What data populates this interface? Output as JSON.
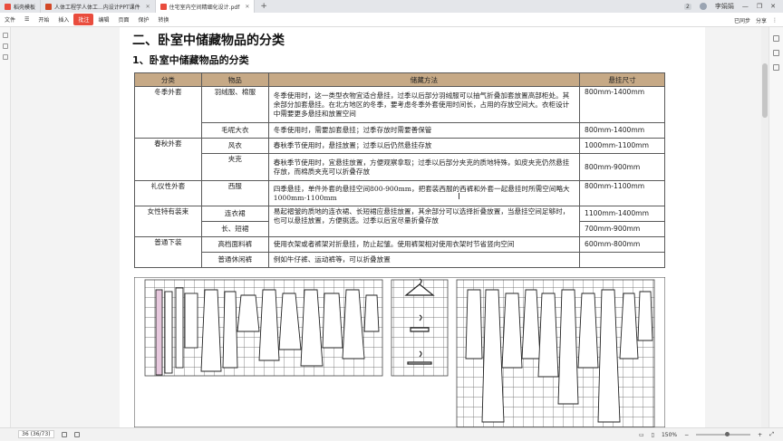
{
  "tabs": [
    {
      "label": "稻壳模板",
      "color": "#e94c3d",
      "active": false
    },
    {
      "label": "人体工程学人体工...内设计PPT课件",
      "color": "#d24726",
      "active": false
    },
    {
      "label": "住宅室内空间精细化设计.pdf",
      "color": "#e94c3d",
      "active": true
    }
  ],
  "window": {
    "badge": "2",
    "user": "李娟娟"
  },
  "menu": {
    "file": "文件",
    "items": [
      "开始",
      "插入",
      "批注",
      "编辑",
      "页面",
      "保护",
      "转换"
    ],
    "active_index": 2
  },
  "toolbar_right": {
    "sync": "已同步",
    "share": "分享"
  },
  "doc": {
    "heading": "二、卧室中储藏物品的分类",
    "subheading": "1、卧室中储藏物品的分类",
    "table": {
      "headers": [
        "分类",
        "物品",
        "储藏方法",
        "悬挂尺寸"
      ],
      "rows": [
        {
          "cat": "冬季外套",
          "item": "羽绒服、棉服",
          "method": "冬季使用时，这一类型衣物宜适合悬挂，过季以后部分羽绒服可以抽气折叠加套放置高部柜处。其余部分加套悬挂。在北方地区的冬季，要考虑冬季外套使用时间长，占用的存放空间大。衣柜设计中需要更多悬挂和放置空间",
          "size": "800mm-1400mm"
        },
        {
          "cat": "",
          "item": "毛呢大衣",
          "method": "冬季使用时，需要加套悬挂；过季存放时需要善保管",
          "size": "800mm-1400mm"
        },
        {
          "cat": "春秋外套",
          "item": "风衣",
          "method": "春秋季节使用时，悬挂放置；过季以后仍然悬挂存放",
          "size": "1000mm-1100mm"
        },
        {
          "cat": "",
          "item": "夹克",
          "method": "春秋季节使用时，宜悬挂放置，方便观察拿取；过季以后部分夹克的质地特殊，如皮夹克仍然悬挂存放，而棉质夹克可以折叠存放",
          "size": "800mm-900mm"
        },
        {
          "cat": "礼仪性外套",
          "item": "西服",
          "method": "四季悬挂，单件外套的悬挂空间800-900mm，把套装西服的西裤和外套一起悬挂时所需空间略大1000mm-1100mm",
          "size": "800mm-1100mm"
        },
        {
          "cat": "女性特有装束",
          "item": "连衣裙",
          "method": "易起褶皱的质地的连衣裙、长短裙应悬挂放置，其余部分可以选择折叠放置，当悬挂空间足够时，也可以悬挂放置，方便挑选。过季以后宜尽量折叠存放",
          "size": "1100mm-1400mm"
        },
        {
          "cat": "",
          "item": "长、短裙",
          "method": "",
          "size": "700mm-900mm"
        },
        {
          "cat": "普通下装",
          "item": "高档面料裤",
          "method": "使用衣架或者裤架对折悬挂，防止起皱。使用裤架相对使用衣架时节省竖向空间",
          "size": "600mm-800mm"
        },
        {
          "cat": "",
          "item": "普通休闲裤",
          "method": "例如牛仔裤、运动裤等，可以折叠放置",
          "size": ""
        }
      ]
    }
  },
  "status": {
    "page": "36",
    "page_total": "(36/73)",
    "zoom": "150%"
  }
}
